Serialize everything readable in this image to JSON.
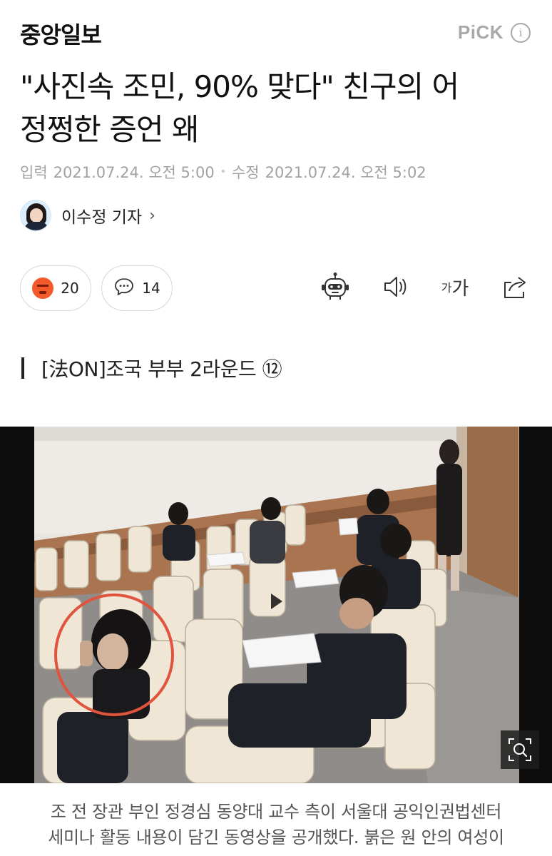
{
  "header": {
    "logo": "중앙일보",
    "pick_label": "PiCK",
    "info_icon": "info-icon"
  },
  "article": {
    "headline_line1": "\"사진속 조민, 90% 맞다\" 친구의 어",
    "headline_line2": "정쩡한 증언 왜",
    "input_label": "입력",
    "input_time": "2021.07.24. 오전 5:00",
    "separator": "•",
    "modified_label": "수정",
    "modified_time": "2021.07.24. 오전 5:02",
    "reporter": "이수정 기자",
    "reporter_chevron": "›"
  },
  "actions": {
    "reaction_icon": "angry-face-icon",
    "reaction_count": "20",
    "comment_icon": "speech-bubble-icon",
    "comment_count": "14",
    "tools": [
      "robot-summary-icon",
      "speaker-icon",
      "font-size-icon",
      "share-icon"
    ],
    "font_small": "가",
    "font_large": "가"
  },
  "series": {
    "title": "[法ON]조국 부부 2라운드 ⑫"
  },
  "photo": {
    "description_icon": "play-icon",
    "zoom_icon": "zoom-icon",
    "highlight_color": "#e0533c"
  },
  "caption": {
    "line1": "조 전 장관 부인 정경심 동양대 교수 측이 서울대 공익인권법센터",
    "line2": "세미나 활동 내용이 담긴 동영상을 공개했다. 붉은 원 안의 여성이"
  },
  "colors": {
    "text": "#111111",
    "muted": "#a2a2a2",
    "reaction": "#f25a2c"
  }
}
